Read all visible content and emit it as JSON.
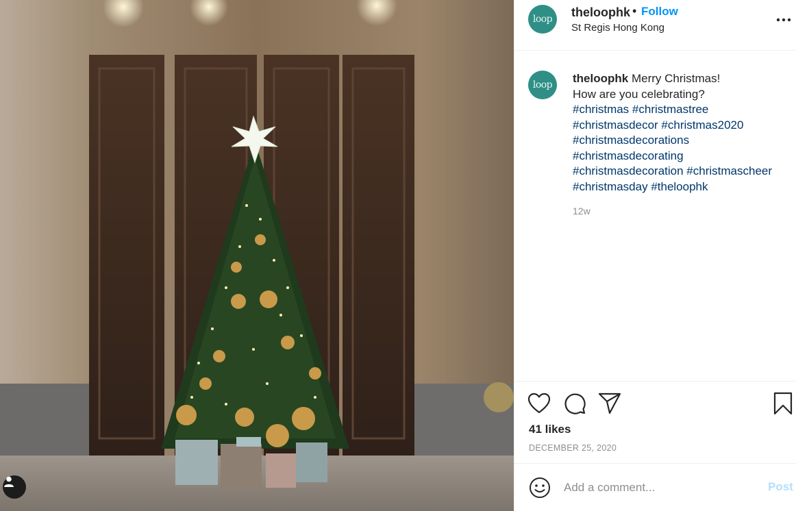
{
  "post": {
    "username": "theloophk",
    "avatar_text": "loop",
    "follow_label": "Follow",
    "separator": "•",
    "location": "St Regis Hong Kong",
    "more_label": "•••"
  },
  "caption": {
    "username": "theloophk",
    "text_line1": "Merry Christmas!",
    "text_line2": "How are you celebrating?",
    "hashtag_lines": [
      "#christmas #christmastree",
      "#christmasdecor #christmas2020",
      "#christmasdecorations",
      "#christmasdecorating",
      "#christmasdecoration #christmascheer",
      "#christmasday #theloophk"
    ],
    "time_ago": "12w"
  },
  "actions": {
    "like_icon": "heart-icon",
    "comment_icon": "comment-icon",
    "share_icon": "paper-plane-icon",
    "save_icon": "bookmark-icon"
  },
  "stats": {
    "likes": "41 likes",
    "date": "DECEMBER 25, 2020"
  },
  "comment": {
    "placeholder": "Add a comment...",
    "post_label": "Post"
  },
  "colors": {
    "accent": "#0095f6",
    "hashtag": "#00376b",
    "post_disabled": "#b2dffc",
    "avatar_bg": "#2f8f86"
  }
}
